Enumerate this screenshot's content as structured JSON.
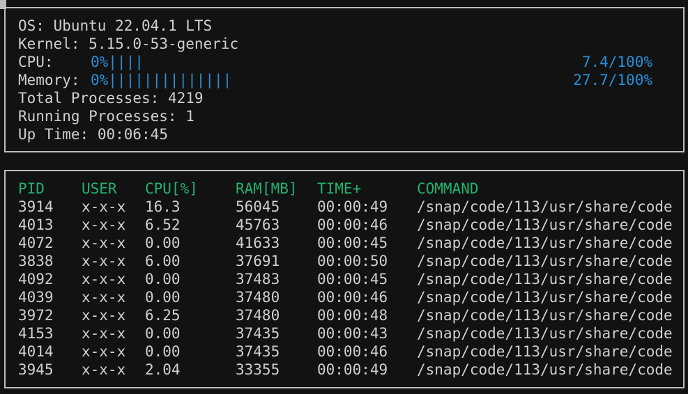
{
  "system": {
    "os_label": "OS:",
    "os_value": "Ubuntu 22.04.1 LTS",
    "kernel_label": "Kernel:",
    "kernel_value": "5.15.0-53-generic",
    "cpu_label": "CPU:",
    "cpu_bar": "0%||||",
    "cpu_value": "7.4/100%",
    "cpu_percent": 7.4,
    "memory_label": "Memory:",
    "memory_bar": "0%||||||||||||||",
    "memory_value": "27.7/100%",
    "memory_percent": 27.7,
    "total_processes_label": "Total Processes:",
    "total_processes_value": "4219",
    "running_processes_label": "Running Processes:",
    "running_processes_value": "1",
    "uptime_label": "Up Time:",
    "uptime_value": "00:06:45"
  },
  "table": {
    "headers": [
      "PID",
      "USER",
      "CPU[%]",
      "RAM[MB]",
      "TIME+",
      "COMMAND"
    ],
    "rows": [
      [
        "3914",
        "x-x-x",
        "16.3",
        "56045",
        "00:00:49",
        "/snap/code/113/usr/share/code"
      ],
      [
        "4013",
        "x-x-x",
        "6.52",
        "45763",
        "00:00:46",
        "/snap/code/113/usr/share/code"
      ],
      [
        "4072",
        "x-x-x",
        "0.00",
        "41633",
        "00:00:45",
        "/snap/code/113/usr/share/code"
      ],
      [
        "3838",
        "x-x-x",
        "6.00",
        "37691",
        "00:00:50",
        "/snap/code/113/usr/share/code"
      ],
      [
        "4092",
        "x-x-x",
        "0.00",
        "37483",
        "00:00:45",
        "/snap/code/113/usr/share/code"
      ],
      [
        "4039",
        "x-x-x",
        "0.00",
        "37480",
        "00:00:46",
        "/snap/code/113/usr/share/code"
      ],
      [
        "3972",
        "x-x-x",
        "6.25",
        "37480",
        "00:00:48",
        "/snap/code/113/usr/share/code"
      ],
      [
        "4153",
        "x-x-x",
        "0.00",
        "37435",
        "00:00:43",
        "/snap/code/113/usr/share/code"
      ],
      [
        "4014",
        "x-x-x",
        "0.00",
        "37435",
        "00:00:46",
        "/snap/code/113/usr/share/code"
      ],
      [
        "3945",
        "x-x-x",
        "2.04",
        "33355",
        "00:00:49",
        "/snap/code/113/usr/share/code"
      ]
    ]
  },
  "colors": {
    "background": "#121212",
    "text": "#cfcfcf",
    "accent_blue": "#2a8fd6",
    "header_green": "#21b26e",
    "border": "#bdbdbd"
  }
}
